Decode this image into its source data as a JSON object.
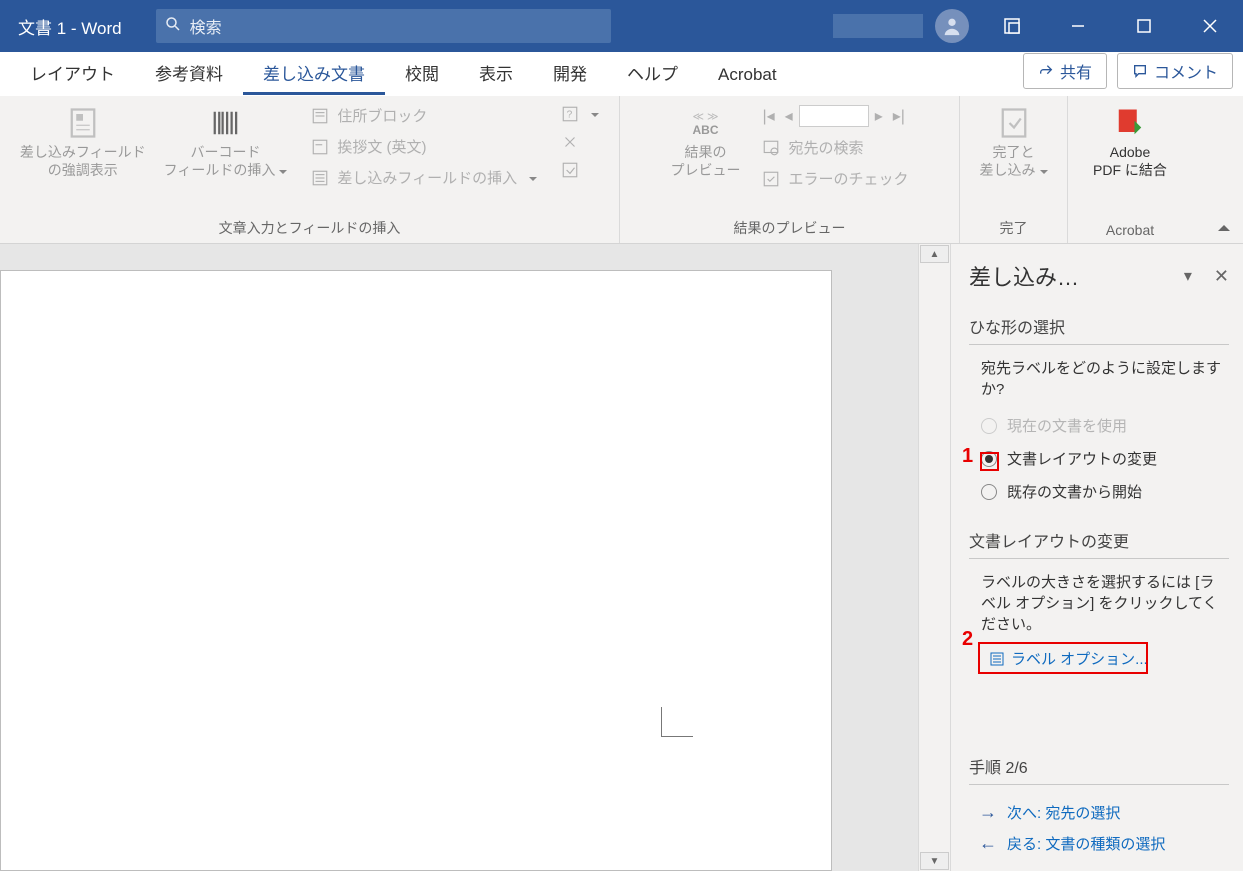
{
  "titlebar": {
    "title": "文書 1  -  Word",
    "search_placeholder": "検索"
  },
  "winbuttons": {
    "ribbon_mode": "",
    "min": "",
    "max": "",
    "close": ""
  },
  "tabs": {
    "layout": "レイアウト",
    "references": "参考資料",
    "mailings": "差し込み文書",
    "review": "校閲",
    "view": "表示",
    "developer": "開発",
    "help": "ヘルプ",
    "acrobat": "Acrobat"
  },
  "tabbtns": {
    "share": "共有",
    "comment": "コメント"
  },
  "ribbon": {
    "group1": {
      "highlight": "差し込みフィールド\nの強調表示",
      "barcode": "バーコード\nフィールドの挿入",
      "address_block": "住所ブロック",
      "greeting_line": "挨拶文 (英文)",
      "insert_merge_field": "差し込みフィールドの挿入",
      "label": "文章入力とフィールドの挿入"
    },
    "group2": {
      "abc_label": "ABC",
      "preview": "結果の\nプレビュー",
      "find_recipient": "宛先の検索",
      "check_errors": "エラーのチェック",
      "label": "結果のプレビュー"
    },
    "group3": {
      "finish": "完了と\n差し込み",
      "label": "完了"
    },
    "group4": {
      "adobe": "Adobe\nPDF に結合",
      "label": "Acrobat"
    }
  },
  "pane": {
    "title": "差し込み…",
    "sec1_title": "ひな形の選択",
    "sec1_prompt": "宛先ラベルをどのように設定しますか?",
    "opt_current": "現在の文書を使用",
    "opt_change": "文書レイアウトの変更",
    "opt_existing": "既存の文書から開始",
    "sec2_title": "文書レイアウトの変更",
    "sec2_desc": "ラベルの大きさを選択するには [ラベル オプション] をクリックしてください。",
    "label_options": "ラベル オプション...",
    "step_title": "手順 2/6",
    "next": "次へ: 宛先の選択",
    "back": "戻る: 文書の種類の選択"
  },
  "annotations": {
    "n1": "1",
    "n2": "2"
  }
}
